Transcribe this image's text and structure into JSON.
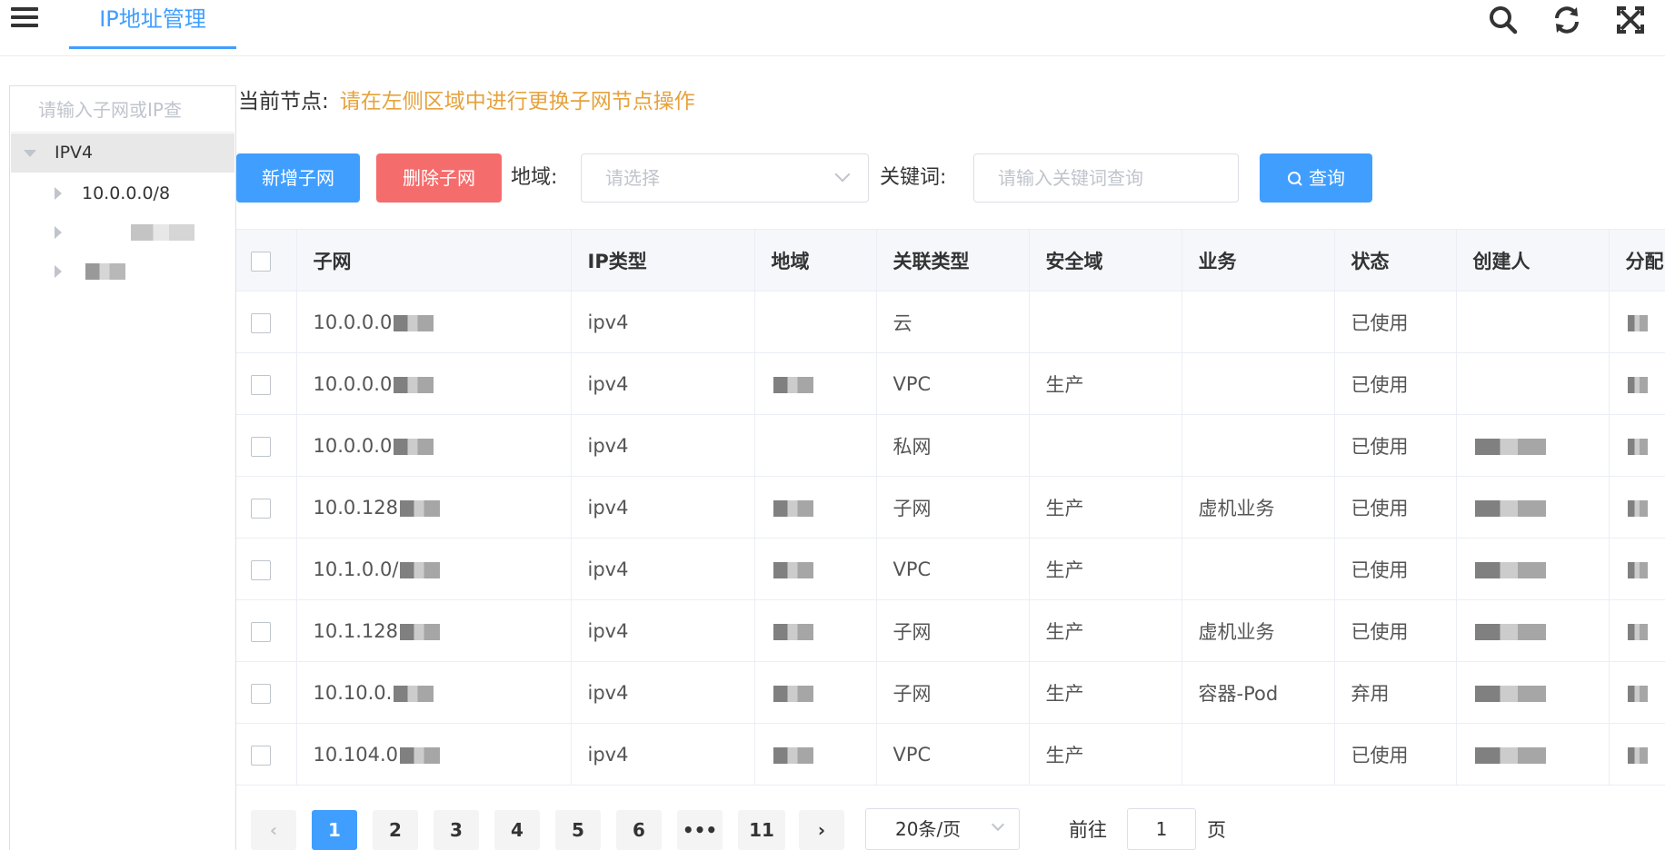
{
  "header": {
    "tab_label": "IP地址管理",
    "icons": [
      "menu-icon",
      "search-icon",
      "refresh-icon",
      "fullscreen-icon"
    ]
  },
  "tree": {
    "search_placeholder": "请输入子网或IP查",
    "root_label": "IPV4",
    "children": [
      "10.0.0.0/8"
    ]
  },
  "current_node": {
    "label": "当前节点:",
    "value": "请在左侧区域中进行更换子网节点操作"
  },
  "toolbar": {
    "add_label": "新增子网",
    "delete_label": "删除子网",
    "region_label": "地域:",
    "region_placeholder": "请选择",
    "keyword_label": "关键词:",
    "keyword_placeholder": "请输入关键词查询",
    "query_label": "查询"
  },
  "table": {
    "headers": [
      "子网",
      "IP类型",
      "地域",
      "关联类型",
      "安全域",
      "业务",
      "状态",
      "创建人",
      "分配"
    ],
    "rows": [
      {
        "subnet": "10.0.0.0",
        "ip_type": "ipv4",
        "region": "",
        "link_type": "云",
        "security": "",
        "business": "",
        "status": "已使用"
      },
      {
        "subnet": "10.0.0.0",
        "ip_type": "ipv4",
        "region": "",
        "link_type": "VPC",
        "security": "生产",
        "business": "",
        "status": "已使用"
      },
      {
        "subnet": "10.0.0.0",
        "ip_type": "ipv4",
        "region": "",
        "link_type": "私网",
        "security": "",
        "business": "",
        "status": "已使用"
      },
      {
        "subnet": "10.0.128",
        "ip_type": "ipv4",
        "region": "",
        "link_type": "子网",
        "security": "生产",
        "business": "虚机业务",
        "status": "已使用"
      },
      {
        "subnet": "10.1.0.0/",
        "ip_type": "ipv4",
        "region": "",
        "link_type": "VPC",
        "security": "生产",
        "business": "",
        "status": "已使用"
      },
      {
        "subnet": "10.1.128",
        "ip_type": "ipv4",
        "region": "",
        "link_type": "子网",
        "security": "生产",
        "business": "虚机业务",
        "status": "已使用"
      },
      {
        "subnet": "10.10.0.",
        "ip_type": "ipv4",
        "region": "",
        "link_type": "子网",
        "security": "生产",
        "business": "容器-Pod",
        "status": "弃用"
      },
      {
        "subnet": "10.104.0",
        "ip_type": "ipv4",
        "region": "",
        "link_type": "VPC",
        "security": "生产",
        "business": "",
        "status": "已使用"
      }
    ]
  },
  "pagination": {
    "prev": "‹",
    "pages": [
      "1",
      "2",
      "3",
      "4",
      "5",
      "6",
      "•••",
      "11"
    ],
    "next": "›",
    "current": "1",
    "page_size": "20条/页",
    "goto_label": "前往",
    "goto_value": "1",
    "page_suffix": "页"
  },
  "colors": {
    "primary": "#409eff",
    "danger": "#f56c6c",
    "warning": "#e6a23c"
  }
}
